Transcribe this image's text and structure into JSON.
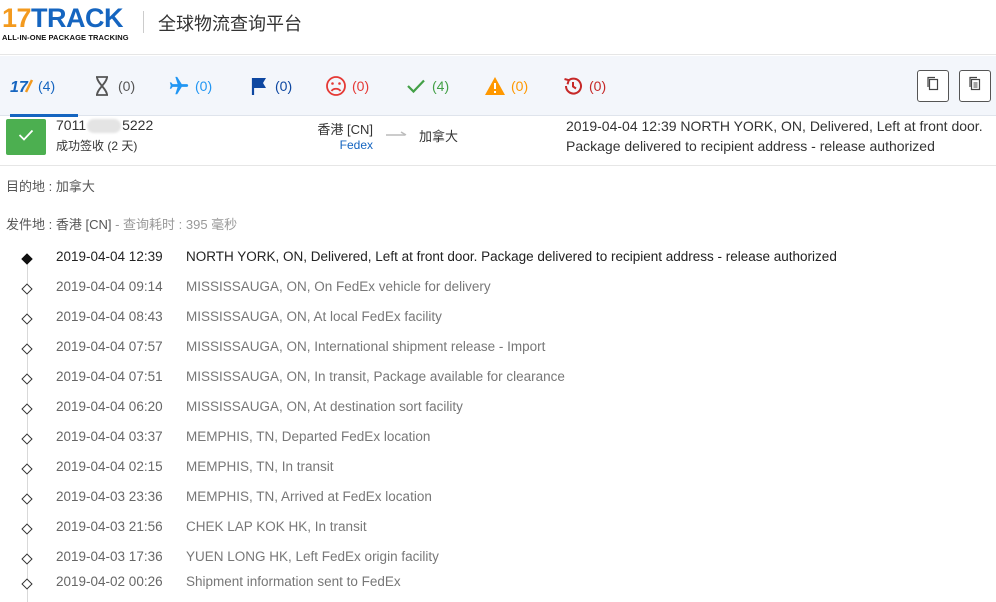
{
  "header": {
    "logo_number": "17",
    "logo_word": "TRACK",
    "logo_tagline": "ALL-IN-ONE PACKAGE TRACKING",
    "title": "全球物流查询平台"
  },
  "tabs": [
    {
      "icon": "17track-icon",
      "count": "(4)",
      "color": "#1565c0"
    },
    {
      "icon": "hourglass-icon",
      "count": "(0)",
      "color": "#555555"
    },
    {
      "icon": "airplane-icon",
      "count": "(0)",
      "color": "#2196f3"
    },
    {
      "icon": "flag-icon",
      "count": "(0)",
      "color": "#0d47a1"
    },
    {
      "icon": "sad-face-icon",
      "count": "(0)",
      "color": "#e53935"
    },
    {
      "icon": "checkmark-icon",
      "count": "(4)",
      "color": "#43a047"
    },
    {
      "icon": "warning-icon",
      "count": "(0)",
      "color": "#ff9800"
    },
    {
      "icon": "history-icon",
      "count": "(0)",
      "color": "#c62828"
    }
  ],
  "toolbar": {
    "copy_icon": "copy-icon",
    "copy_all_icon": "copy-all-icon"
  },
  "summary": {
    "tracking_prefix": "7011",
    "tracking_suffix": "5222",
    "status": "成功签收 (2 天)",
    "origin": "香港 [CN]",
    "carrier": "Fedex",
    "destination": "加拿大",
    "latest_event": "2019-04-04 12:39  NORTH YORK, ON, Delivered, Left at front door. Package delivered to recipient address - release authorized",
    "status_color": "#4caf50"
  },
  "info": {
    "destination_label": "目的地 : ",
    "destination_value": "加拿大",
    "origin_label": "发件地 : ",
    "origin_value": "香港 [CN]",
    "query_time": " - 查询耗时 : 395 毫秒"
  },
  "events": [
    {
      "time": "2019-04-04 12:39",
      "desc": "NORTH YORK, ON, Delivered, Left at front door. Package delivered to recipient address - release authorized"
    },
    {
      "time": "2019-04-04 09:14",
      "desc": "MISSISSAUGA, ON, On FedEx vehicle for delivery"
    },
    {
      "time": "2019-04-04 08:43",
      "desc": "MISSISSAUGA, ON, At local FedEx facility"
    },
    {
      "time": "2019-04-04 07:57",
      "desc": "MISSISSAUGA, ON, International shipment release - Import"
    },
    {
      "time": "2019-04-04 07:51",
      "desc": "MISSISSAUGA, ON, In transit, Package available for clearance"
    },
    {
      "time": "2019-04-04 06:20",
      "desc": "MISSISSAUGA, ON, At destination sort facility"
    },
    {
      "time": "2019-04-04 03:37",
      "desc": "MEMPHIS, TN, Departed FedEx location"
    },
    {
      "time": "2019-04-04 02:15",
      "desc": "MEMPHIS, TN, In transit"
    },
    {
      "time": "2019-04-03 23:36",
      "desc": "MEMPHIS, TN, Arrived at FedEx location"
    },
    {
      "time": "2019-04-03 21:56",
      "desc": "CHEK LAP KOK HK, In transit"
    },
    {
      "time": "2019-04-03 17:36",
      "desc": "YUEN LONG HK, Left FedEx origin facility"
    },
    {
      "time": "2019-04-02 00:26",
      "desc": "Shipment information sent to FedEx"
    }
  ]
}
